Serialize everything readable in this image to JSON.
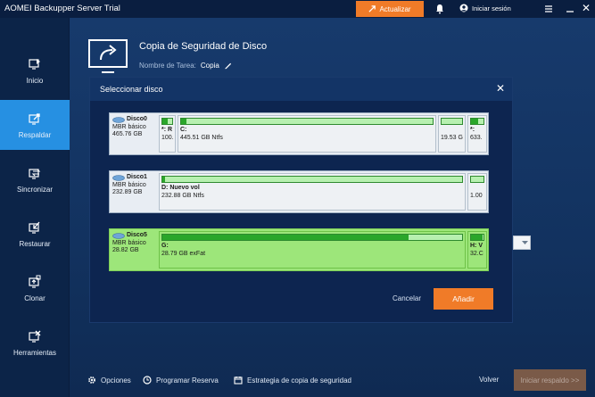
{
  "titlebar": {
    "app_title": "AOMEI Backupper Server Trial",
    "update_label": "Actualizar",
    "login_label": "Iniciar sesión"
  },
  "sidebar": {
    "items": [
      {
        "label": "Inicio",
        "icon": "home-icon",
        "active": false
      },
      {
        "label": "Respaldar",
        "icon": "backup-icon",
        "active": true
      },
      {
        "label": "Sincronizar",
        "icon": "sync-icon",
        "active": false
      },
      {
        "label": "Restaurar",
        "icon": "restore-icon",
        "active": false
      },
      {
        "label": "Clonar",
        "icon": "clone-icon",
        "active": false
      },
      {
        "label": "Herramientas",
        "icon": "tools-icon",
        "active": false
      }
    ]
  },
  "task": {
    "title": "Copia de Seguridad de Disco",
    "name_label": "Nombre de Tarea:",
    "name_value": "Copia"
  },
  "modal": {
    "title": "Seleccionar disco",
    "cancel_label": "Cancelar",
    "add_label": "Añadir",
    "disks": [
      {
        "name": "Disco0",
        "type": "MBR básico",
        "size": "465.76 GB",
        "selected": false,
        "partitions": [
          {
            "letter": "*: R",
            "detail": "100.",
            "fill": 0.55
          },
          {
            "letter": "C:",
            "detail": "445.51 GB Ntfs",
            "fill": 0.02
          },
          {
            "letter": "",
            "detail": "19.53 G",
            "fill": 0.0
          },
          {
            "letter": "*:",
            "detail": "633.",
            "fill": 0.6
          }
        ]
      },
      {
        "name": "Disco1",
        "type": "MBR básico",
        "size": "232.89 GB",
        "selected": false,
        "partitions": [
          {
            "letter": "D: Nuevo vol",
            "detail": "232.88 GB Ntfs",
            "fill": 0.01
          },
          {
            "letter": "",
            "detail": "1.00",
            "fill": 0.0
          }
        ]
      },
      {
        "name": "Disco5",
        "type": "MBR básico",
        "size": "28.82 GB",
        "selected": true,
        "partitions": [
          {
            "letter": "G:",
            "detail": "28.79 GB exFat",
            "fill": 0.82
          },
          {
            "letter": "H: V",
            "detail": "32.C",
            "fill": 0.9
          }
        ]
      }
    ]
  },
  "footer": {
    "options_label": "Opciones",
    "schedule_label": "Programar Reserva",
    "strategy_label": "Estrategia de copia de seguridad",
    "back_label": "Volver",
    "start_label": "Iniciar respaldo >>"
  },
  "colors": {
    "accent": "#f07b28",
    "active_nav": "#2690e2",
    "selected_disk": "#9de67a",
    "bar_fill": "#2aa62a"
  }
}
